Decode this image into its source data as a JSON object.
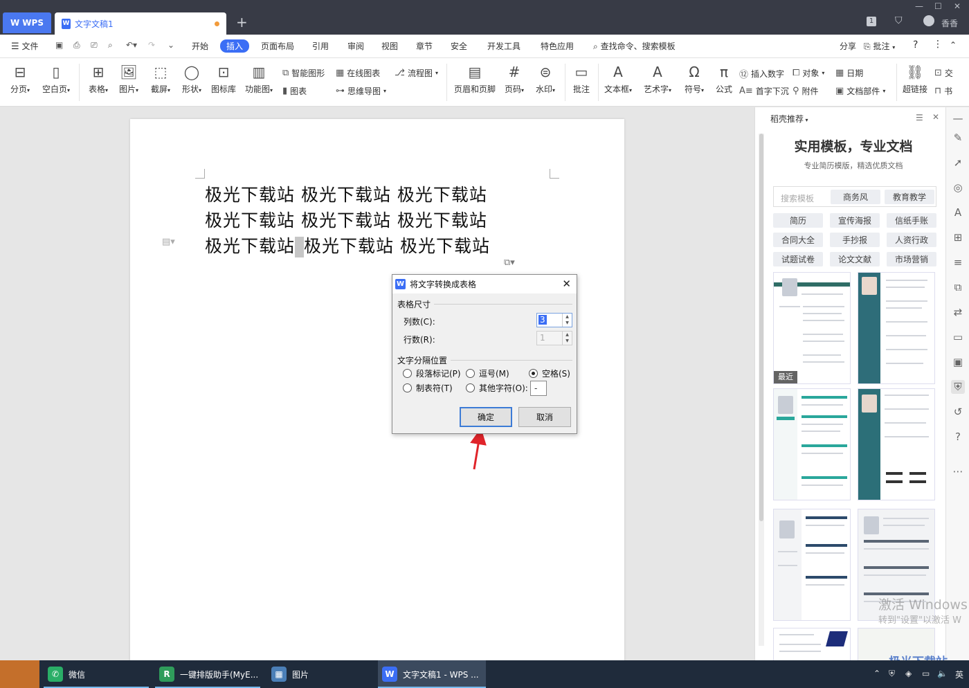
{
  "titlebar": {
    "app_tab": "WPS",
    "doc_tab": "文字文稿1",
    "user_name": "香香",
    "page_count_badge": "1"
  },
  "menu": {
    "file": "文件",
    "items": [
      "开始",
      "插入",
      "页面布局",
      "引用",
      "审阅",
      "视图",
      "章节",
      "安全",
      "开发工具",
      "特色应用"
    ],
    "active": "插入",
    "search_placeholder": "查找命令、搜索模板",
    "share": "分享",
    "comment": "批注"
  },
  "ribbon": {
    "page_break": "分页",
    "blank_page": "空白页",
    "table": "表格",
    "picture": "图片",
    "screenshot": "截屏",
    "shape": "形状",
    "icon_lib": "图标库",
    "function_chart": "功能图",
    "smart_shape": "智能图形",
    "online_chart": "在线图表",
    "flowchart": "流程图",
    "chart": "图表",
    "mindmap": "思维导图",
    "header_footer": "页眉和页脚",
    "page_num": "页码",
    "watermark": "水印",
    "comment": "批注",
    "textbox": "文本框",
    "art_text": "艺术字",
    "symbol": "符号",
    "formula": "公式",
    "insert_number": "插入数字",
    "object": "对象",
    "date": "日期",
    "drop_cap": "首字下沉",
    "attachment": "附件",
    "doc_parts": "文档部件",
    "hyperlink": "超链接",
    "crossref": "交",
    "bookmark": "书"
  },
  "document": {
    "lines": [
      "极光下载站 极光下载站 极光下载站",
      "极光下载站 极光下载站 极光下载站",
      "极光下载站",
      "极光下载站 极光下载站"
    ]
  },
  "dialog": {
    "title": "将文字转换成表格",
    "size_group": "表格尺寸",
    "cols_label": "列数(C):",
    "cols_value": "3",
    "rows_label": "行数(R):",
    "rows_value": "1",
    "sep_group": "文字分隔位置",
    "opt_paragraph": "段落标记(P)",
    "opt_comma": "逗号(M)",
    "opt_space": "空格(S)",
    "opt_tab": "制表符(T)",
    "opt_other": "其他字符(O):",
    "other_value": "-",
    "selected": "空格(S)",
    "ok": "确定",
    "cancel": "取消"
  },
  "panel": {
    "header": "稻壳推荐",
    "headline": "实用模板，专业文档",
    "subline": "专业简历模版，精选优质文档",
    "search_placeholder": "搜索模板",
    "tag_business": "商务风",
    "tag_edu": "教育教学",
    "categories": [
      "简历",
      "宣传海报",
      "信纸手账",
      "合同大全",
      "手抄报",
      "人资行政",
      "试题试卷",
      "论文文献",
      "市场营销"
    ],
    "recent_badge": "最近"
  },
  "watermark": {
    "line1": "激活 Windows",
    "line2": "转到\"设置\"以激活 W",
    "logo": "极光下载站"
  },
  "taskbar": {
    "items": [
      "微信",
      "一键排版助手(MyE...",
      "图片",
      "文字文稿1 - WPS ..."
    ],
    "ime": "英"
  },
  "colors": {
    "accent": "#3b6ef5",
    "titlebar": "#383b46",
    "taskbar": "#1f2b3b",
    "arrow": "#e0242a"
  }
}
